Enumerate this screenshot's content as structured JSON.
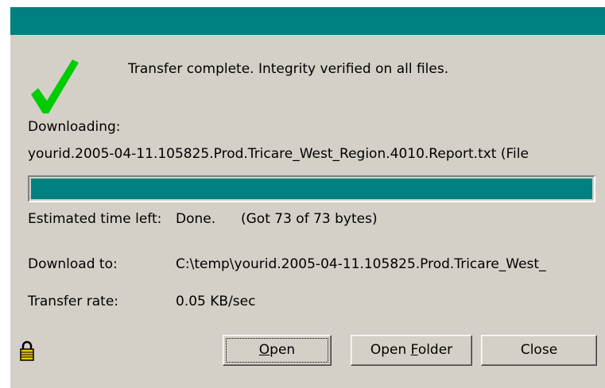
{
  "colors": {
    "titlebar": "#008080",
    "progress_fill": "#008080",
    "dialog_background": "#d4d0c8",
    "check_mark": "#00cc00",
    "lock_icon": "#e8c800"
  },
  "icons": {
    "status": "checkmark-icon",
    "security": "lock-icon"
  },
  "status": {
    "message": "Transfer complete.  Integrity verified on all files."
  },
  "download": {
    "label": "Downloading:",
    "file_name": "yourid.2005-04-11.105825.Prod.Tricare_West_Region.4010.Report.txt (File",
    "progress_fraction": 1.0
  },
  "details": {
    "time_left_label": "Estimated time left:",
    "time_left_value": "Done.",
    "bytes_info": "(Got 73 of 73 bytes)",
    "download_to_label": "Download to:",
    "download_to_value": "C:\\temp\\yourid.2005-04-11.105825.Prod.Tricare_West_",
    "transfer_rate_label": "Transfer rate:",
    "transfer_rate_value": "0.05 KB/sec"
  },
  "buttons": {
    "open": {
      "accel": "O",
      "rest": "pen"
    },
    "open_folder": {
      "before": "Open ",
      "accel": "F",
      "rest": "older"
    },
    "close": {
      "label": "Close"
    }
  }
}
